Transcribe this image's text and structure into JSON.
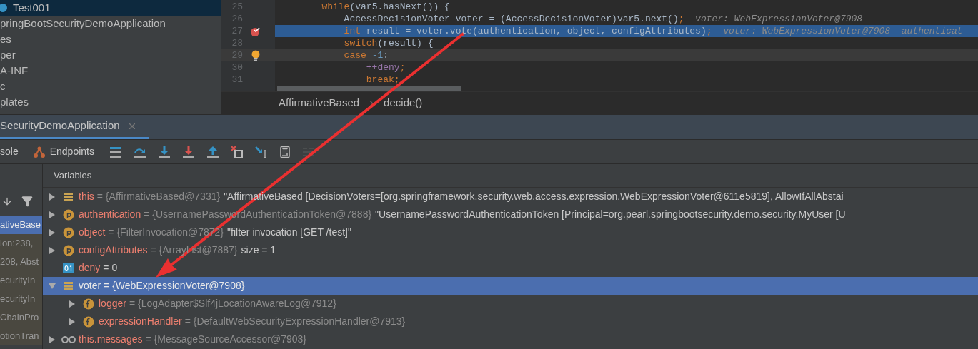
{
  "project_tree": [
    {
      "label": "Test001",
      "kind": "module",
      "selected": true
    },
    {
      "label": "pringBootSecurityDemoApplication",
      "kind": "plain",
      "selected": false
    },
    {
      "label": "es",
      "kind": "plain",
      "selected": false
    },
    {
      "label": "per",
      "kind": "plain",
      "selected": false
    },
    {
      "label": "A-INF",
      "kind": "plain",
      "selected": false
    },
    {
      "label": "c",
      "kind": "plain",
      "selected": false
    },
    {
      "label": "plates",
      "kind": "plain",
      "selected": false
    }
  ],
  "editor": {
    "lines": [
      {
        "number": "25",
        "execution_point": false,
        "caret_line": false,
        "breakpoint": false,
        "bulb": false,
        "tokens": [
          {
            "kind": "keyword",
            "text": "        while"
          },
          {
            "kind": "plain",
            "text": "(var5.hasNext()) {"
          }
        ]
      },
      {
        "number": "26",
        "execution_point": false,
        "caret_line": false,
        "breakpoint": false,
        "bulb": false,
        "tokens": [
          {
            "kind": "plain",
            "text": "            AccessDecisionVoter voter = (AccessDecisionVoter)var5.next()"
          },
          {
            "kind": "keyword",
            "text": ";"
          },
          {
            "kind": "debug",
            "text": "  voter: WebExpressionVoter@7908"
          }
        ]
      },
      {
        "number": "27",
        "execution_point": true,
        "caret_line": false,
        "breakpoint": true,
        "bulb": false,
        "tokens": [
          {
            "kind": "keyword",
            "text": "            int"
          },
          {
            "kind": "plain",
            "text": " result = voter.vote(authentication, object, configAttributes)"
          },
          {
            "kind": "keyword",
            "text": ";"
          },
          {
            "kind": "debug",
            "text": "  voter: WebExpressionVoter@7908  authenticat"
          }
        ]
      },
      {
        "number": "28",
        "execution_point": false,
        "caret_line": false,
        "breakpoint": false,
        "bulb": false,
        "tokens": [
          {
            "kind": "keyword",
            "text": "            switch"
          },
          {
            "kind": "plain",
            "text": "(result) {"
          }
        ]
      },
      {
        "number": "29",
        "execution_point": false,
        "caret_line": true,
        "breakpoint": false,
        "bulb": true,
        "tokens": [
          {
            "kind": "keyword",
            "text": "            case "
          },
          {
            "kind": "number",
            "text": "-1"
          },
          {
            "kind": "plain",
            "text": ":"
          }
        ]
      },
      {
        "number": "30",
        "execution_point": false,
        "caret_line": false,
        "breakpoint": false,
        "bulb": false,
        "tokens": [
          {
            "kind": "field",
            "text": "                ++deny"
          },
          {
            "kind": "keyword",
            "text": ";"
          }
        ]
      },
      {
        "number": "31",
        "execution_point": false,
        "caret_line": false,
        "breakpoint": false,
        "bulb": false,
        "tokens": [
          {
            "kind": "keyword",
            "text": "                break;"
          }
        ]
      }
    ],
    "breadcrumbs": [
      "AffirmativeBased",
      "decide()"
    ]
  },
  "debug_tab": {
    "label": "SecurityDemoApplication",
    "selected": true
  },
  "toolbar": [
    {
      "kind": "console",
      "label": "sole",
      "disabled": false
    },
    {
      "kind": "endpoints",
      "label": "Endpoints",
      "disabled": false
    },
    {
      "kind": "frames",
      "disabled": false
    },
    {
      "kind": "step-over",
      "disabled": false
    },
    {
      "kind": "step-into",
      "disabled": false
    },
    {
      "kind": "force-step-into",
      "disabled": false
    },
    {
      "kind": "step-out",
      "disabled": false
    },
    {
      "kind": "drop-frame",
      "disabled": false
    },
    {
      "kind": "run-to-cursor",
      "disabled": false
    },
    {
      "kind": "evaluate",
      "disabled": false
    },
    {
      "kind": "trace",
      "disabled": true
    }
  ],
  "frames": [
    {
      "label": "ativeBase",
      "selected": true
    },
    {
      "label": "ion:238,",
      "selected": false
    },
    {
      "label": "208, Abst",
      "selected": false
    },
    {
      "label": "ecurityIn",
      "selected": false
    },
    {
      "label": "ecurityIn",
      "selected": false
    },
    {
      "label": "ChainPro",
      "selected": false
    },
    {
      "label": "otionTran",
      "selected": false
    }
  ],
  "variables": {
    "title": "Variables",
    "rows": [
      {
        "kind": "object",
        "name": "this",
        "type": "= {AffirmativeBased@7331}",
        "value": "\"AffirmativeBased [DecisionVoters=[org.springframework.security.web.access.expression.WebExpressionVoter@611e5819], AllowIfAllAbstai",
        "expanded": false,
        "selected": false
      },
      {
        "kind": "param",
        "name": "authentication",
        "type": "= {UsernamePasswordAuthenticationToken@7888}",
        "value": "\"UsernamePasswordAuthenticationToken [Principal=org.pearl.springbootsecurity.demo.security.MyUser [U",
        "expanded": false,
        "selected": false
      },
      {
        "kind": "param",
        "name": "object",
        "type": "= {FilterInvocation@7872}",
        "value": "\"filter invocation [GET /test]\"",
        "expanded": false,
        "selected": false
      },
      {
        "kind": "param",
        "name": "configAttributes",
        "type": "= {ArrayList@7887}",
        "value": "size = 1",
        "expanded": false,
        "selected": false
      },
      {
        "kind": "primitive",
        "name": "deny",
        "value": "= 0",
        "selected": false
      },
      {
        "kind": "object",
        "name": "voter",
        "type": "= {WebExpressionVoter@7908}",
        "expanded": true,
        "selected": true,
        "children": [
          {
            "kind": "field",
            "name": "logger",
            "type": "= {LogAdapter$Slf4jLocationAwareLog@7912}",
            "expanded": false,
            "selected": false
          },
          {
            "kind": "field",
            "name": "expressionHandler",
            "type": "= {DefaultWebSecurityExpressionHandler@7913}",
            "expanded": false,
            "selected": false
          }
        ]
      },
      {
        "kind": "watch",
        "name": "this.messages",
        "type": "= {MessageSourceAccessor@7903}",
        "expanded": false,
        "selected": false
      }
    ]
  }
}
